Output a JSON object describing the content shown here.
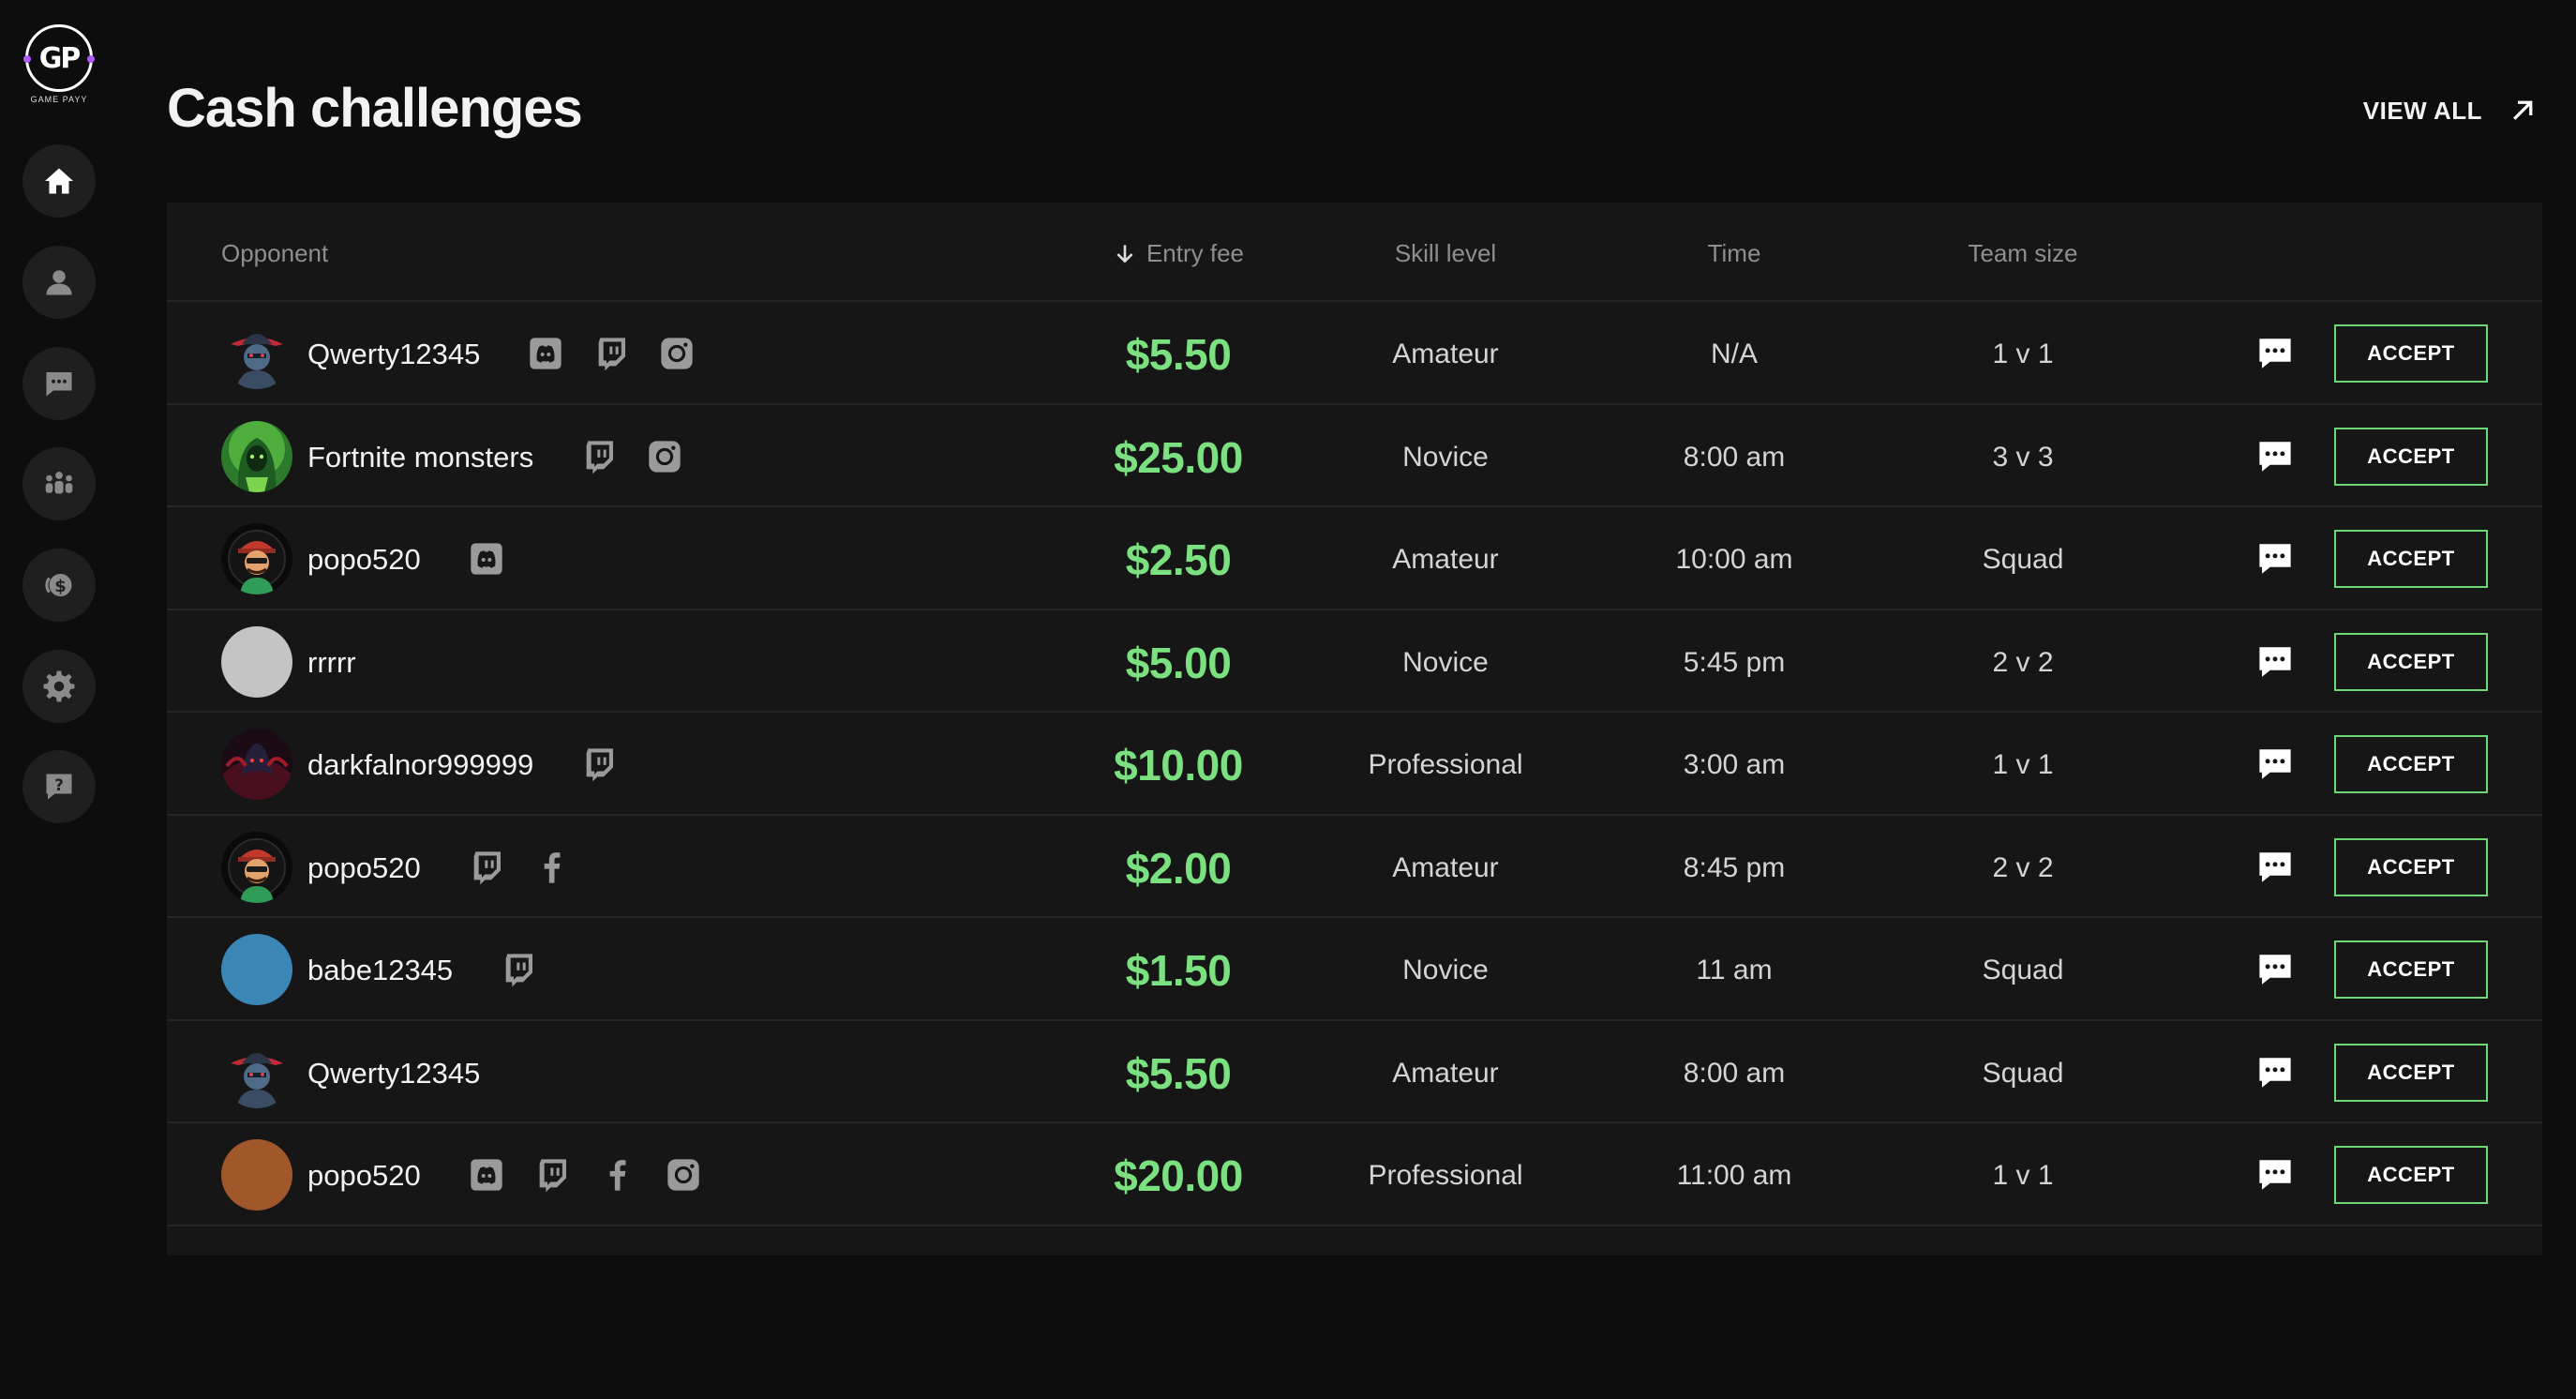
{
  "brand": {
    "logo_text": "GP",
    "logo_sub": "GAME PAYY"
  },
  "sidebar": {
    "items": [
      {
        "icon": "home-icon",
        "active": true
      },
      {
        "icon": "user-icon"
      },
      {
        "icon": "chat-icon"
      },
      {
        "icon": "team-icon"
      },
      {
        "icon": "coin-icon"
      },
      {
        "icon": "gear-icon"
      },
      {
        "icon": "help-icon"
      }
    ]
  },
  "header": {
    "title": "Cash challenges",
    "view_all": "VIEW ALL"
  },
  "table": {
    "columns": {
      "opponent": "Opponent",
      "entry_fee": "Entry fee",
      "skill_level": "Skill level",
      "time": "Time",
      "team_size": "Team size"
    },
    "accept_label": "ACCEPT",
    "rows": [
      {
        "name": "Qwerty12345",
        "avatar": "cowboy-avatar",
        "socials": [
          "discord",
          "twitch",
          "instagram"
        ],
        "fee": "$5.50",
        "skill": "Amateur",
        "time": "N/A",
        "team": "1 v 1"
      },
      {
        "name": "Fortnite monsters",
        "avatar": "hooded-avatar",
        "socials": [
          "twitch",
          "instagram"
        ],
        "fee": "$25.00",
        "skill": "Novice",
        "time": "8:00 am",
        "team": "3 v 3"
      },
      {
        "name": "popo520",
        "avatar": "mascot-avatar",
        "socials": [
          "discord"
        ],
        "fee": "$2.50",
        "skill": "Amateur",
        "time": "10:00 am",
        "team": "Squad"
      },
      {
        "name": "rrrrr",
        "avatar": "gray-avatar",
        "socials": [],
        "fee": "$5.00",
        "skill": "Novice",
        "time": "5:45 pm",
        "team": "2 v 2"
      },
      {
        "name": "darkfalnor999999",
        "avatar": "dark-avatar",
        "socials": [
          "twitch"
        ],
        "fee": "$10.00",
        "skill": "Professional",
        "time": "3:00 am",
        "team": "1 v 1"
      },
      {
        "name": "popo520",
        "avatar": "mascot-avatar",
        "socials": [
          "twitch",
          "facebook"
        ],
        "fee": "$2.00",
        "skill": "Amateur",
        "time": "8:45 pm",
        "team": "2 v 2"
      },
      {
        "name": "babe12345",
        "avatar": "blue-avatar",
        "socials": [
          "twitch"
        ],
        "fee": "$1.50",
        "skill": "Novice",
        "time": "11 am",
        "team": "Squad"
      },
      {
        "name": "Qwerty12345",
        "avatar": "cowboy-avatar",
        "socials": [],
        "fee": "$5.50",
        "skill": "Amateur",
        "time": "8:00 am",
        "team": "Squad"
      },
      {
        "name": "popo520",
        "avatar": "orange-avatar",
        "socials": [
          "discord",
          "twitch",
          "facebook",
          "instagram"
        ],
        "fee": "$20.00",
        "skill": "Professional",
        "time": "11:00 am",
        "team": "1 v 1"
      }
    ]
  },
  "colors": {
    "background": "#0d0d0d",
    "panel": "#161616",
    "fee_green": "#7be07f",
    "accept_border": "#6dd873",
    "gray_avatar": "#c4c4c4",
    "blue_avatar": "#3a86b4",
    "orange_avatar": "#a0572a"
  }
}
